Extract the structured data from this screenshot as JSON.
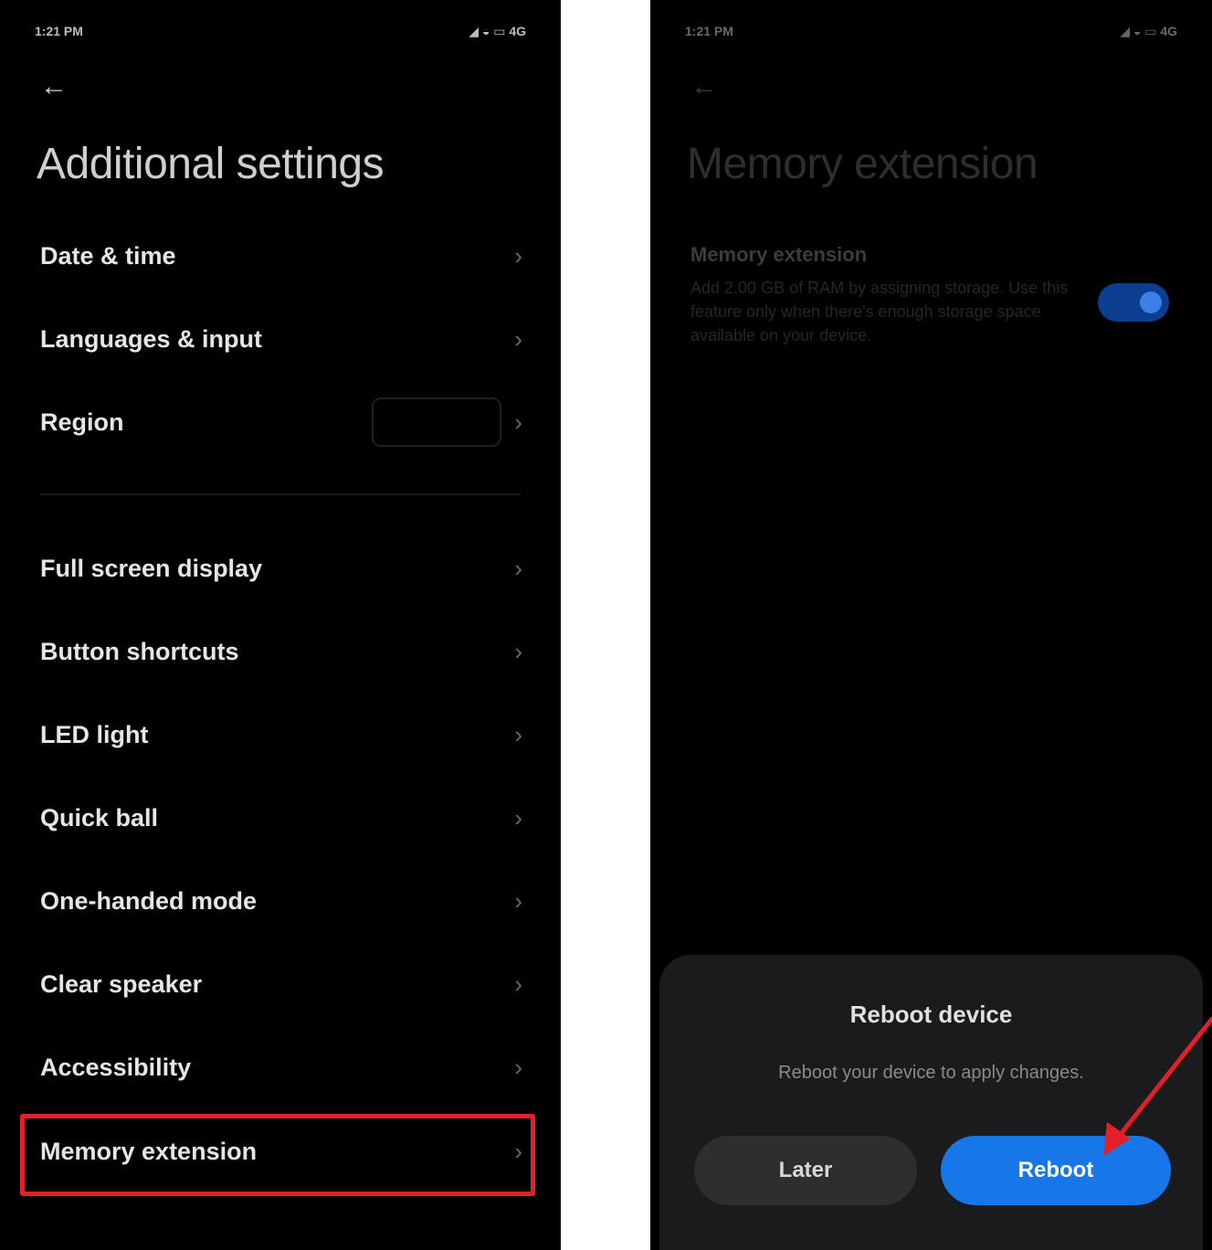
{
  "left_screen": {
    "status": {
      "time": "1:21 PM",
      "icons": "◢ ◒ ▭ 4G"
    },
    "back_icon": "back-arrow-icon",
    "title": "Additional settings",
    "items": [
      {
        "label": "Date & time"
      },
      {
        "label": "Languages & input"
      },
      {
        "label": "Region"
      },
      {
        "label": "Full screen display"
      },
      {
        "label": "Button shortcuts"
      },
      {
        "label": "LED light"
      },
      {
        "label": "Quick ball"
      },
      {
        "label": "One-handed mode"
      },
      {
        "label": "Clear speaker"
      },
      {
        "label": "Accessibility"
      },
      {
        "label": "Memory extension"
      }
    ],
    "highlight_color": "#e22028"
  },
  "right_screen": {
    "status": {
      "time": "1:21 PM",
      "icons": "◢ ◒ ▭ 4G"
    },
    "title": "Memory extension",
    "setting": {
      "title": "Memory extension",
      "description": "Add 2.00 GB of RAM by assigning storage. Use this feature only when there's enough storage space available on your device.",
      "enabled": true
    },
    "dialog": {
      "title": "Reboot device",
      "message": "Reboot your device to apply changes.",
      "later_label": "Later",
      "reboot_label": "Reboot"
    },
    "accent_color": "#1877e8",
    "arrow_color": "#e22028"
  }
}
